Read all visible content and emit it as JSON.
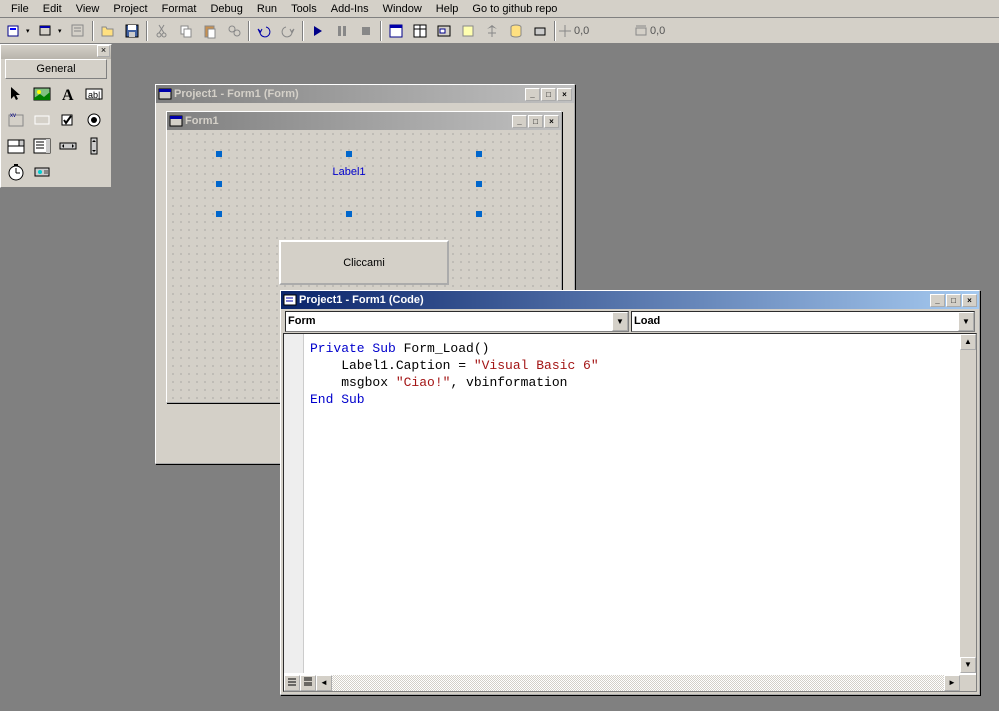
{
  "menu": {
    "items": [
      "File",
      "Edit",
      "View",
      "Project",
      "Format",
      "Debug",
      "Run",
      "Tools",
      "Add-Ins",
      "Window",
      "Help",
      "Go to github repo"
    ]
  },
  "toolbar": {
    "coord1": "0,0",
    "coord2": "0,0"
  },
  "toolbox": {
    "tab": "General"
  },
  "designer": {
    "title": "Project1 - Form1 (Form)",
    "form_title": "Form1",
    "label_caption": "Label1",
    "button_caption": "Cliccami"
  },
  "code": {
    "title": "Project1 - Form1 (Code)",
    "combo_object": "Form",
    "combo_proc": "Load",
    "lines": {
      "l1a": "Private Sub",
      "l1b": " Form_Load()",
      "l2a": "    Label1.Caption = ",
      "l2b": "\"Visual Basic 6\"",
      "l3a": "    msgbox ",
      "l3b": "\"Ciao!\"",
      "l3c": ", vbinformation",
      "l4": "End Sub"
    }
  }
}
